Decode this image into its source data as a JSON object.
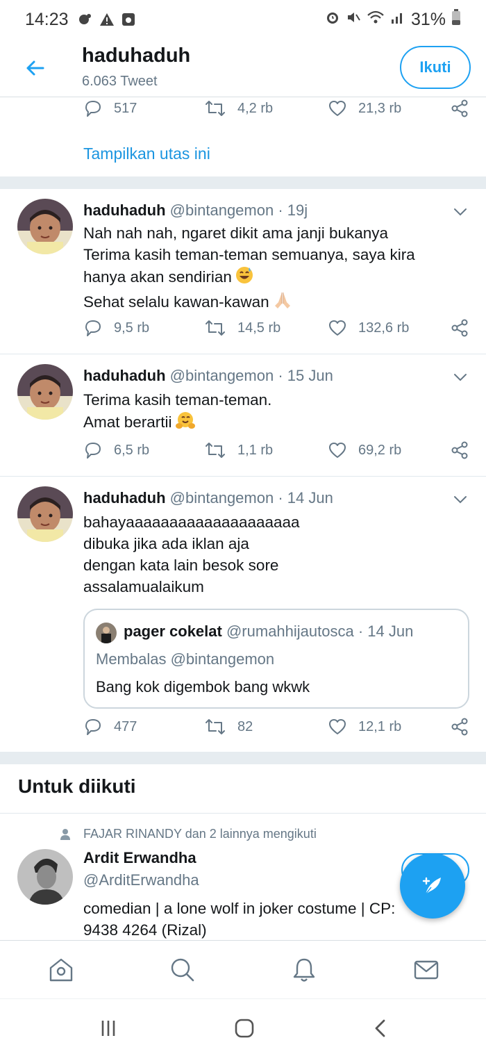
{
  "status_bar": {
    "time": "14:23",
    "battery": "31%",
    "icons": [
      "game-controller-icon",
      "warning-icon",
      "camera-icon",
      "alarm-icon",
      "mute-icon",
      "wifi-icon",
      "signal-icon",
      "battery-icon"
    ]
  },
  "header": {
    "title": "haduhaduh",
    "subtitle": "6.063 Tweet",
    "follow_label": "Ikuti"
  },
  "top_actions": {
    "replies": "517",
    "retweets": "4,2 rb",
    "likes": "21,3 rb"
  },
  "show_thread_label": "Tampilkan utas ini",
  "tweets": [
    {
      "name": "haduhaduh",
      "handle": "@bintangemon",
      "time": " · 19j",
      "lines": [
        "Nah nah nah, ngaret dikit ama janji bukanya",
        "Terima kasih teman-teman semuanya, saya kira",
        "hanya akan sendirian",
        "Sehat selalu kawan-kawan"
      ],
      "replies": "9,5 rb",
      "retweets": "14,5 rb",
      "likes": "132,6 rb"
    },
    {
      "name": "haduhaduh",
      "handle": "@bintangemon",
      "time": " · 15 Jun",
      "lines": [
        "Terima kasih teman-teman.",
        "Amat berartii"
      ],
      "replies": "6,5 rb",
      "retweets": "1,1 rb",
      "likes": "69,2 rb"
    },
    {
      "name": "haduhaduh",
      "handle": "@bintangemon",
      "time": " · 14 Jun",
      "lines": [
        "bahayaaaaaaaaaaaaaaaaaaaa",
        "dibuka jika ada iklan aja",
        "dengan kata lain besok sore",
        "assalamualaikum"
      ],
      "quote": {
        "name": "pager cokelat",
        "handle": "@rumahhijautosca",
        "time": " · 14 Jun",
        "reply_to": "Membalas @bintangemon",
        "text": "Bang kok digembok bang wkwk"
      },
      "replies": "477",
      "retweets": "82",
      "likes": "12,1 rb"
    }
  ],
  "who_to_follow": {
    "title": "Untuk diikuti",
    "context": "FAJAR RINANDY dan 2 lainnya mengikuti",
    "name": "Ardit Erwandha",
    "handle": "@ArditErwandha",
    "bio_lines": [
      "comedian | a lone wolf in joker costume | CP:",
      "9438 4264 (Rizal)"
    ]
  },
  "bottom_nav": [
    "home-icon",
    "search-icon",
    "notifications-icon",
    "messages-icon"
  ],
  "colors": {
    "accent": "#1da1f2",
    "text": "#14171a",
    "muted": "#657786",
    "separator": "#e6ecf0"
  }
}
